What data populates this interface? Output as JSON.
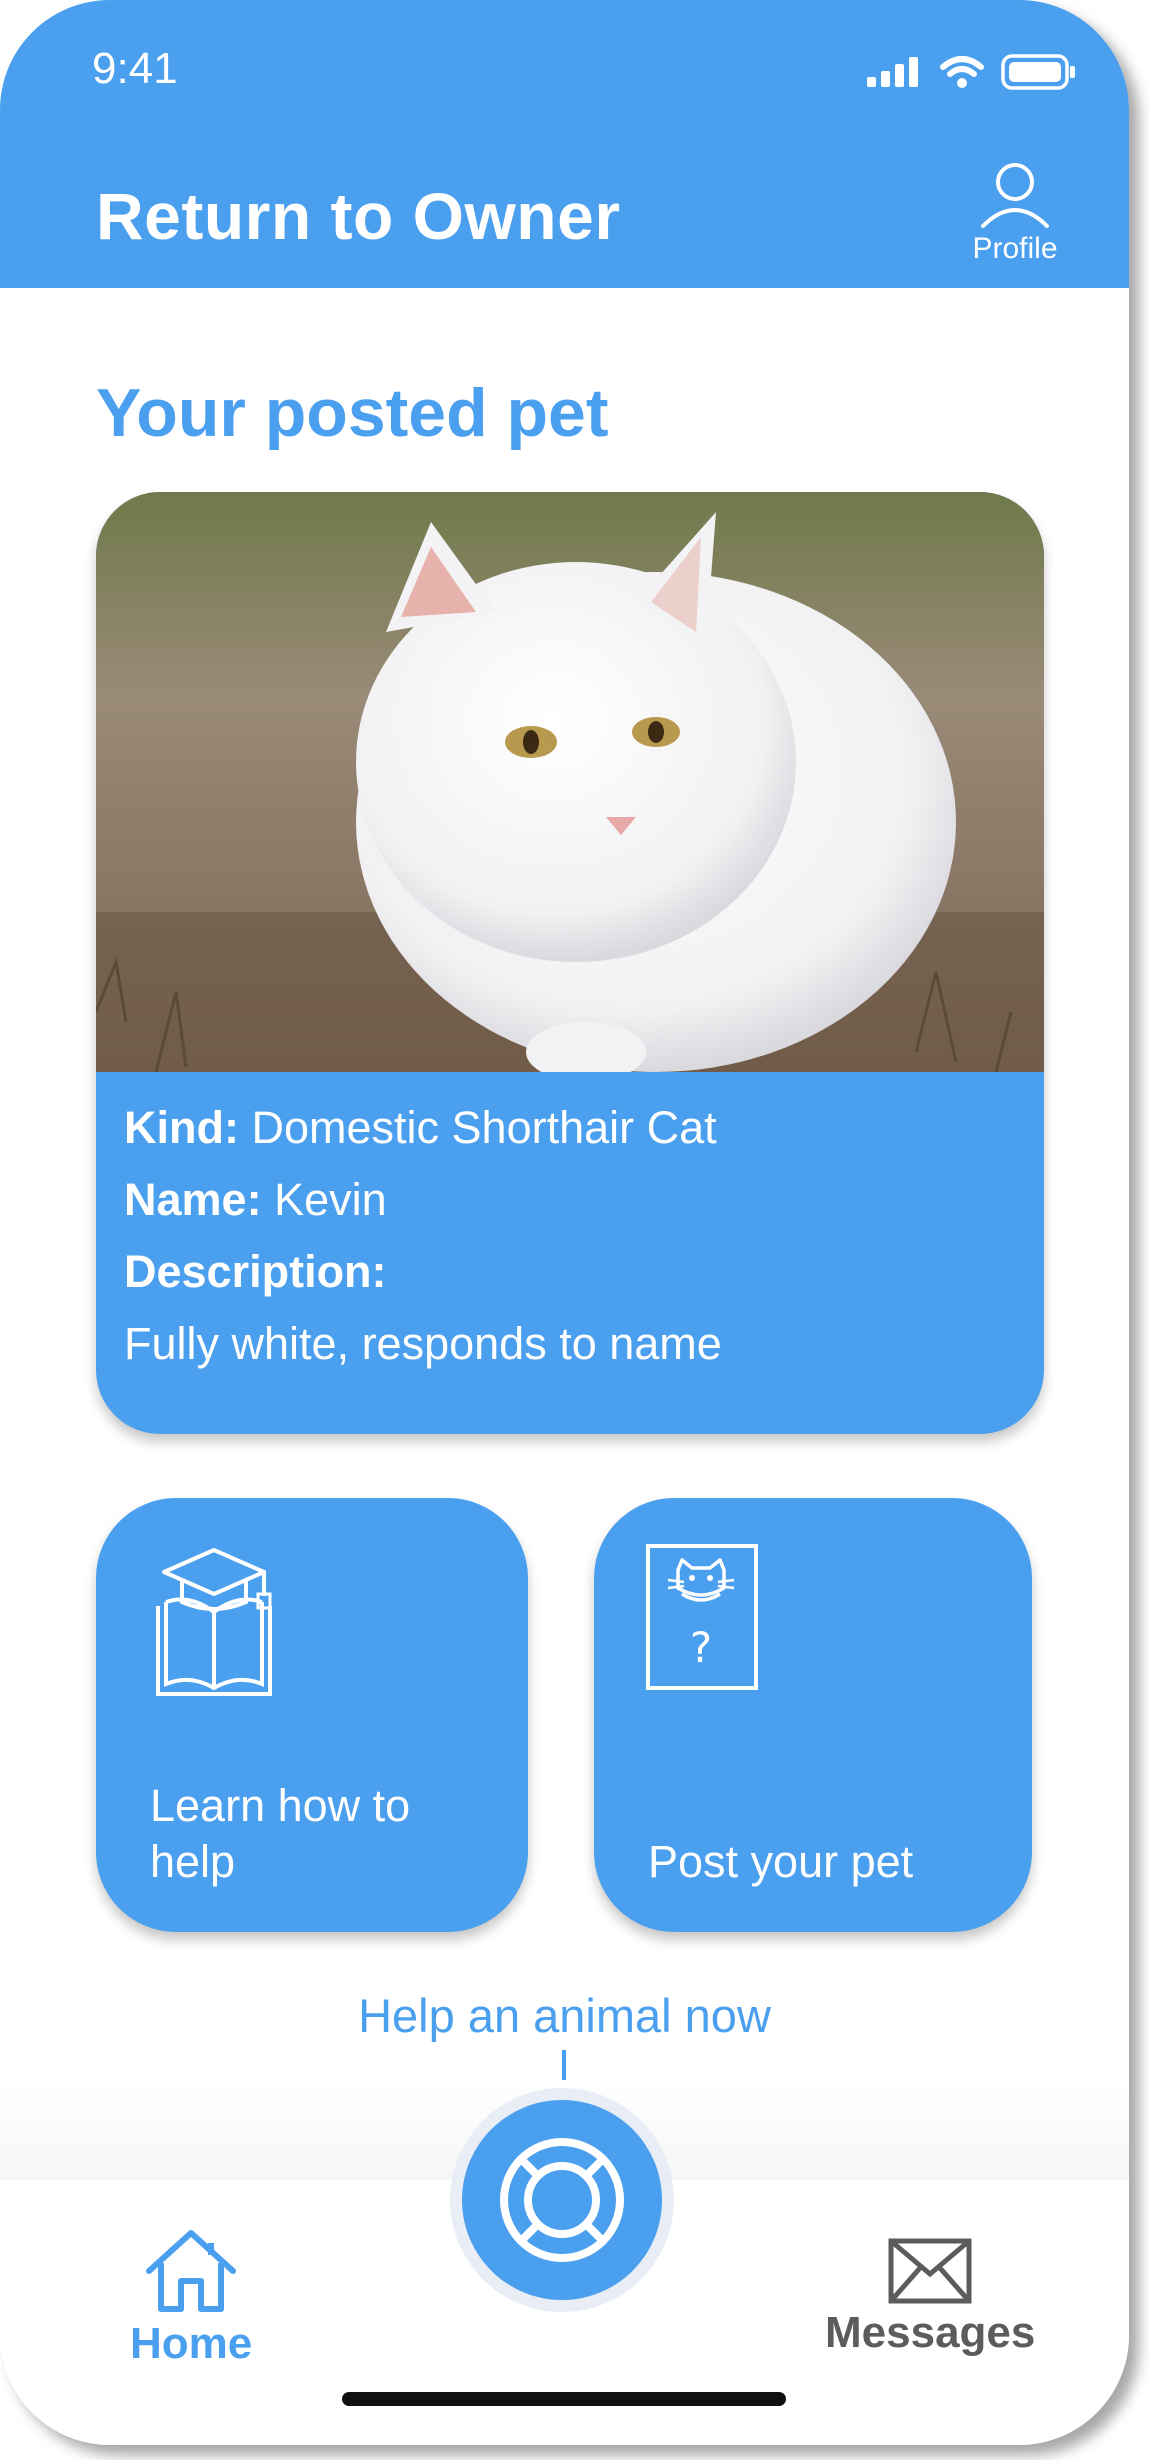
{
  "status_bar": {
    "time": "9:41"
  },
  "header": {
    "title": "Return to Owner",
    "profile_label": "Profile"
  },
  "section": {
    "title": "Your posted pet"
  },
  "pet": {
    "kind_label": "Kind:",
    "kind": "Domestic Shorthair Cat",
    "name_label": "Name:",
    "name": "Kevin",
    "description_label": "Description:",
    "description": "Fully white, responds to name"
  },
  "actions": {
    "learn_label_line1": "Learn how to",
    "learn_label_line2": "help",
    "post_label": "Post your pet"
  },
  "help_prompt": "Help an animal now",
  "tabs": {
    "home": "Home",
    "messages": "Messages"
  },
  "colors": {
    "accent": "#4a9fee",
    "inactive": "#5c5c5c"
  },
  "icons": [
    "signal-icon",
    "wifi-icon",
    "battery-icon",
    "profile-icon",
    "book-graduation-icon",
    "lost-pet-poster-icon",
    "lifebuoy-icon",
    "home-icon",
    "mail-icon"
  ]
}
